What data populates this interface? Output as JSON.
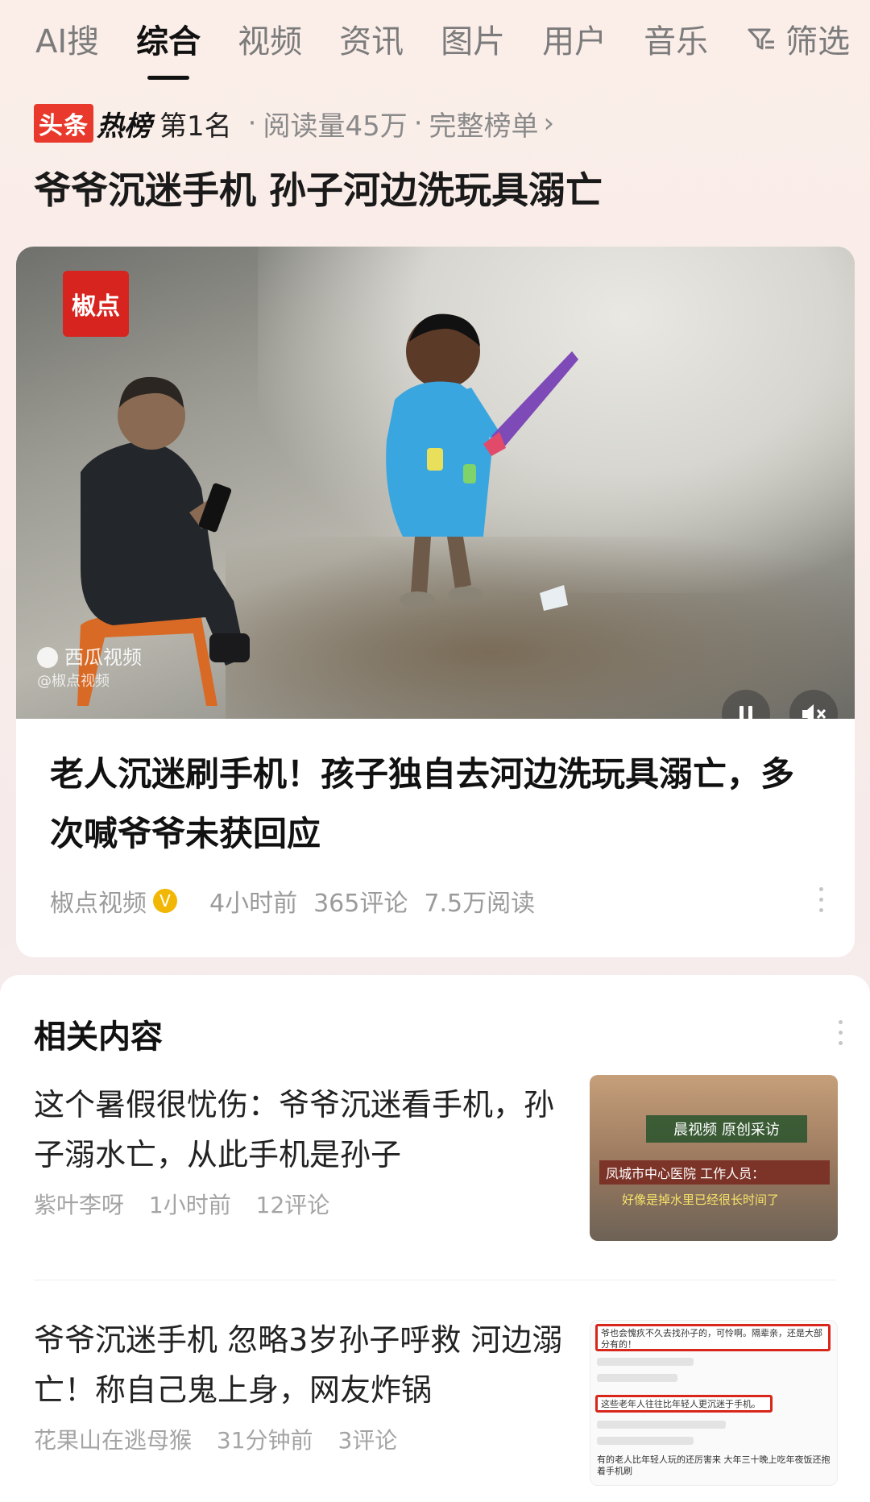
{
  "tabs": [
    {
      "label": "AI搜",
      "active": false
    },
    {
      "label": "综合",
      "active": true
    },
    {
      "label": "视频",
      "active": false
    },
    {
      "label": "资讯",
      "active": false
    },
    {
      "label": "图片",
      "active": false
    },
    {
      "label": "用户",
      "active": false
    },
    {
      "label": "音乐",
      "active": false
    }
  ],
  "filter_label": "筛选",
  "hot": {
    "logo_a": "头条",
    "logo_b": "热榜",
    "rank": "第1名",
    "reads": "阅读量45万",
    "full_list": "完整榜单",
    "chevron": "›"
  },
  "headline": "爷爷沉迷手机 孙子河边洗玩具溺亡",
  "card": {
    "brand_badge": "椒点",
    "watermark": "西瓜视频",
    "watermark_sub": "@椒点视频",
    "title": "老人沉迷刷手机！孩子独自去河边洗玩具溺亡，多次喊爷爷未获回应",
    "author": "椒点视频",
    "verified_mark": "V",
    "time": "4小时前",
    "comments": "365评论",
    "reads": "7.5万阅读"
  },
  "related": {
    "heading": "相关内容",
    "items": [
      {
        "title": "这个暑假很忧伤：爷爷沉迷看手机，孙子溺水亡，从此手机是孙子",
        "author": "紫叶李呀",
        "time": "1小时前",
        "comments": "12评论",
        "thumb_text1": "晨视频 原创采访",
        "thumb_text2": "凤城市中心医院 工作人员：",
        "thumb_text3": "好像是掉水里已经很长时间了"
      },
      {
        "title": "爷爷沉迷手机 忽略3岁孙子呼救 河边溺亡！称自己鬼上身，网友炸锅",
        "author": "花果山在逃母猴",
        "time": "31分钟前",
        "comments": "3评论",
        "thumb_text1": "爷也会愧疚不久去找孙子的，可怜啊。隔辈亲，还是大部分有的！",
        "thumb_text2": "这些老年人往往比年轻人更沉迷于手机。",
        "thumb_text3": "有的老人比年轻人玩的还厉害来 大年三十晚上吃年夜饭还抱着手机刷"
      }
    ]
  }
}
